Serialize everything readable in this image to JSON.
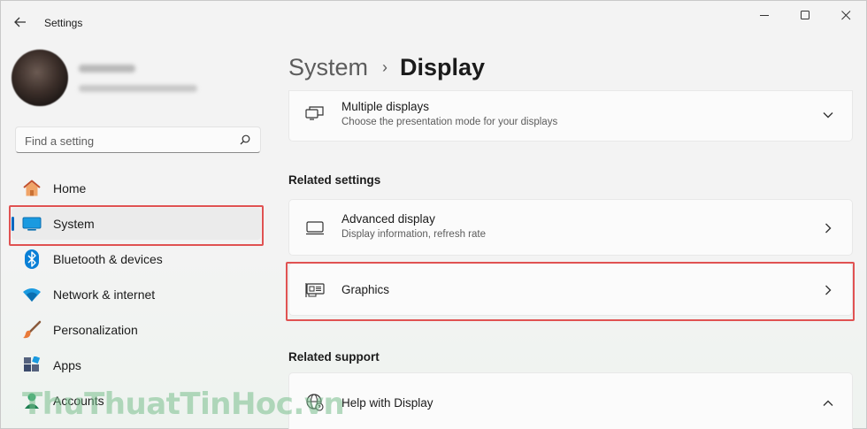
{
  "window": {
    "title": "Settings",
    "controls": {
      "minimize": "—",
      "maximize": "☐",
      "close": "✕"
    }
  },
  "sidebar": {
    "search_placeholder": "Find a setting",
    "items": [
      {
        "label": "Home",
        "icon": "home-icon",
        "active": false
      },
      {
        "label": "System",
        "icon": "system-icon",
        "active": true
      },
      {
        "label": "Bluetooth & devices",
        "icon": "bluetooth-icon",
        "active": false
      },
      {
        "label": "Network & internet",
        "icon": "wifi-icon",
        "active": false
      },
      {
        "label": "Personalization",
        "icon": "brush-icon",
        "active": false
      },
      {
        "label": "Apps",
        "icon": "apps-icon",
        "active": false
      },
      {
        "label": "Accounts",
        "icon": "accounts-icon",
        "active": false
      }
    ]
  },
  "main": {
    "breadcrumb": {
      "parent": "System",
      "separator": "›",
      "current": "Display"
    },
    "multiple_displays": {
      "title": "Multiple displays",
      "subtitle": "Choose the presentation mode for your displays"
    },
    "related_settings": {
      "heading": "Related settings",
      "advanced_display": {
        "title": "Advanced display",
        "subtitle": "Display information, refresh rate"
      },
      "graphics": {
        "title": "Graphics"
      }
    },
    "related_support": {
      "heading": "Related support",
      "help": {
        "title": "Help with Display"
      }
    }
  },
  "watermark": "ThuThuatTinHoc.vn",
  "colors": {
    "accent": "#0067c0",
    "highlight_box": "#e05252"
  }
}
